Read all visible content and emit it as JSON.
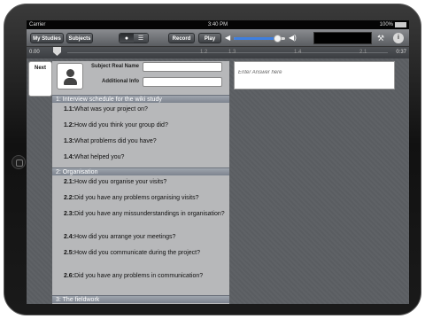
{
  "statusbar": {
    "carrier": "Carrier",
    "time": "3:40 PM",
    "battery": "100%"
  },
  "toolbar": {
    "my_studies": "My Studies",
    "subjects": "Subjects",
    "record": "Record",
    "play": "Play",
    "volume_level": 0.85
  },
  "timeline": {
    "start": "0.00",
    "end": "0:37",
    "ticks": [
      "1.2",
      "1.3",
      "1.4",
      "2.1"
    ],
    "position": 0.0
  },
  "next_label": "Next",
  "subject": {
    "real_name_label": "Subject Real Name",
    "real_name_value": "",
    "additional_info_label": "Additional Info",
    "additional_info_value": ""
  },
  "answer": {
    "placeholder": "Enter Answer here"
  },
  "sections": [
    {
      "title": "1: Interview schedule for the wiki study",
      "questions": [
        {
          "num": "1.1:",
          "text": "What was your project on?"
        },
        {
          "num": "1.2:",
          "text": "How did you think your group did?"
        },
        {
          "num": "1.3:",
          "text": "What problems did you have?"
        },
        {
          "num": "1.4:",
          "text": "What helped you?"
        }
      ]
    },
    {
      "title": "2: Organisation",
      "questions": [
        {
          "num": "2.1:",
          "text": "How did you organise your visits?"
        },
        {
          "num": "2.2:",
          "text": "Did you have any problems organising visits?"
        },
        {
          "num": "2.3:",
          "text": "Did you have any missunderstandings in organisation?"
        },
        {
          "num": "2.4:",
          "text": "How did you arrange your meetings?"
        },
        {
          "num": "2.5:",
          "text": "How did you communicate during the project?"
        },
        {
          "num": "2.6:",
          "text": "Did you have any problems in communication?"
        }
      ]
    },
    {
      "title": "3: The fieldwork",
      "questions": []
    }
  ]
}
